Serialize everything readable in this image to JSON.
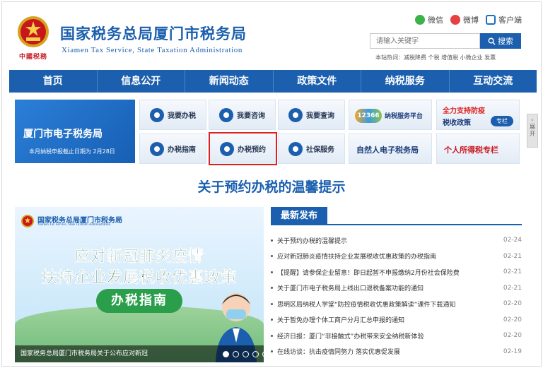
{
  "header": {
    "emblem_text": "中國税務",
    "title": "国家税务总局厦门市税务局",
    "subtitle": "Xiamen Tax Service, State Taxation Administration",
    "social": {
      "wechat": "微信",
      "weibo": "微博",
      "client": "客户端"
    },
    "search": {
      "placeholder": "请输入关键字",
      "button": "搜索"
    },
    "hot_words": "本站热词：减税降费 个税 增值税 小微企业 发票"
  },
  "nav": [
    "首页",
    "信息公开",
    "新闻动态",
    "政策文件",
    "纳税服务",
    "互动交流"
  ],
  "etax": {
    "title": "厦门市电子税务局",
    "note": "本月纳税申报截止日期为 2月28日"
  },
  "quick": [
    {
      "label": "我要办税"
    },
    {
      "label": "我要咨询"
    },
    {
      "label": "我要查询"
    },
    {
      "label": "办税指南"
    },
    {
      "label": "办税预约"
    },
    {
      "label": "社保服务"
    }
  ],
  "promos": {
    "service_badge": "12366",
    "service_platform": "纳税服务平台",
    "epidemic_line1": "全力支持防疫",
    "epidemic_line2": "税收政策",
    "epidemic_tag": "专栏",
    "natural_person": "自然人电子税务局",
    "iit": "个人所得税专栏"
  },
  "side_tab": "展开",
  "headline": "关于预约办税的温馨提示",
  "banner": {
    "org": "国家税务总局厦门市税务局",
    "org_en": "Xiamen Tax Service, State Taxation Administration",
    "line1": "应对新冠肺炎疫情",
    "line2": "扶持企业发展税收优惠政策",
    "pill": "办税指南",
    "caption": "国家税务总局厦门市税务局关于公布应对新冠"
  },
  "news": {
    "tab": "最新发布",
    "items": [
      {
        "title": "关于预约办税的温馨提示",
        "date": "02-24"
      },
      {
        "title": "应对新冠肺炎疫情扶持企业发展税收优惠政策的办税指南",
        "date": "02-21"
      },
      {
        "title": "【提醒】请参保企业留意！即日起暂不申报缴纳2月份社会保险费",
        "date": "02-21"
      },
      {
        "title": "关于厦门市电子税务局上线出口退税备案功能的通知",
        "date": "02-21"
      },
      {
        "title": "思明区局纳税人学堂“防控疫情税收优惠政策解读”课件下载通知",
        "date": "02-20"
      },
      {
        "title": "关于暂免办理个体工商户分月汇总申报的通知",
        "date": "02-20"
      },
      {
        "title": "经济日报：厦门“非接触式”办税带来安全纳税新体验",
        "date": "02-20"
      },
      {
        "title": "在线访谈：抗击疫情同努力 落实优惠促发展",
        "date": "02-19"
      }
    ]
  },
  "colors": {
    "brand_blue": "#1b5fae",
    "alert_red": "#e02020",
    "emblem_red": "#c8161d"
  }
}
